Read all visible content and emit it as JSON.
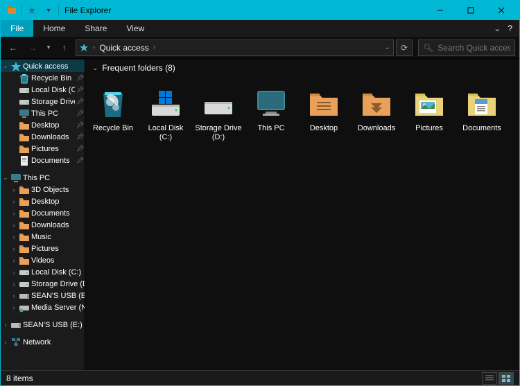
{
  "window": {
    "title": "File Explorer"
  },
  "ribbon": {
    "file": "File",
    "tabs": [
      "Home",
      "Share",
      "View"
    ]
  },
  "address": {
    "location": "Quick access"
  },
  "search": {
    "placeholder": "Search Quick access"
  },
  "sidebar": {
    "groups": [
      {
        "name": "quick-access",
        "label": "Quick access",
        "expanded": true,
        "selected": true,
        "icon": "star",
        "items": [
          {
            "label": "Recycle Bin",
            "icon": "recycle",
            "pinned": true
          },
          {
            "label": "Local Disk (C:)",
            "icon": "drive",
            "pinned": true
          },
          {
            "label": "Storage Drive (D:)",
            "icon": "drive",
            "pinned": true
          },
          {
            "label": "This PC",
            "icon": "pc",
            "pinned": true
          },
          {
            "label": "Desktop",
            "icon": "folder-orange",
            "pinned": true
          },
          {
            "label": "Downloads",
            "icon": "folder-orange",
            "pinned": true
          },
          {
            "label": "Pictures",
            "icon": "folder-orange",
            "pinned": true
          },
          {
            "label": "Documents",
            "icon": "doc",
            "pinned": true
          }
        ]
      },
      {
        "name": "this-pc",
        "label": "This PC",
        "expanded": true,
        "icon": "pc",
        "items": [
          {
            "label": "3D Objects",
            "icon": "folder-orange",
            "expandable": true
          },
          {
            "label": "Desktop",
            "icon": "folder-orange",
            "expandable": true
          },
          {
            "label": "Documents",
            "icon": "folder-orange",
            "expandable": true
          },
          {
            "label": "Downloads",
            "icon": "folder-orange",
            "expandable": true
          },
          {
            "label": "Music",
            "icon": "folder-orange",
            "expandable": true
          },
          {
            "label": "Pictures",
            "icon": "folder-orange",
            "expandable": true
          },
          {
            "label": "Videos",
            "icon": "folder-orange",
            "expandable": true
          },
          {
            "label": "Local Disk (C:)",
            "icon": "drive",
            "expandable": true
          },
          {
            "label": "Storage Drive (D:)",
            "icon": "drive",
            "expandable": true
          },
          {
            "label": "SEAN'S USB (E:)",
            "icon": "usb",
            "expandable": true
          },
          {
            "label": "Media Server (N:)",
            "icon": "netdrive",
            "expandable": true
          }
        ]
      },
      {
        "name": "usb",
        "label": "SEAN'S USB (E:)",
        "icon": "usb",
        "expandable": true
      },
      {
        "name": "network",
        "label": "Network",
        "icon": "network",
        "expandable": true
      }
    ]
  },
  "content": {
    "section_label": "Frequent folders (8)",
    "tiles": [
      {
        "label": "Recycle Bin",
        "icon": "recycle-big"
      },
      {
        "label": "Local Disk (C:)",
        "icon": "drive-win"
      },
      {
        "label": "Storage Drive (D:)",
        "icon": "drive-big"
      },
      {
        "label": "This PC",
        "icon": "pc-big"
      },
      {
        "label": "Desktop",
        "icon": "folder-lines"
      },
      {
        "label": "Downloads",
        "icon": "folder-down"
      },
      {
        "label": "Pictures",
        "icon": "pictures"
      },
      {
        "label": "Documents",
        "icon": "documents"
      }
    ]
  },
  "status": {
    "text": "8 items"
  }
}
